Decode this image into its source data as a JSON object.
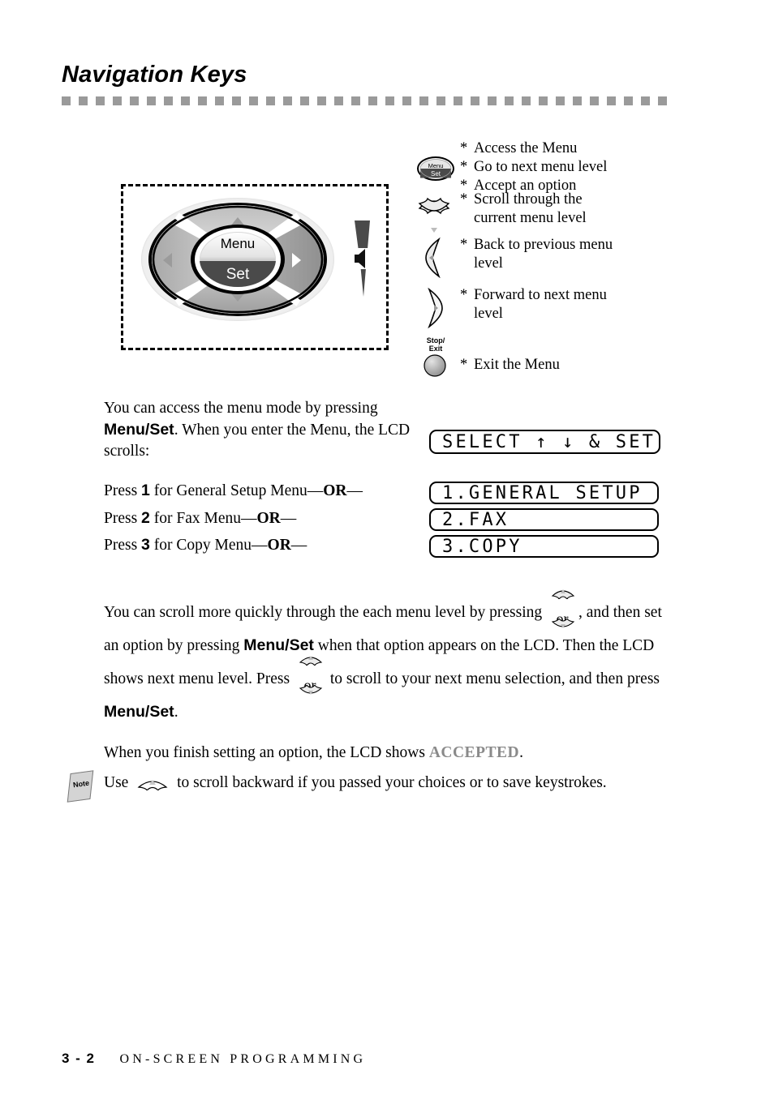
{
  "page": {
    "title": "Navigation Keys"
  },
  "diagram": {
    "navpad": {
      "center_top_label": "Menu",
      "center_bottom_label": "Set",
      "up_key": "up-arrow-key",
      "down_key": "down-arrow-key",
      "left_key": "left-arrow-key",
      "right_key": "right-arrow-key"
    },
    "volume_icon": "speaker-volume-icon"
  },
  "legend": [
    {
      "icon": "menu-set-key-icon",
      "lines": [
        "Access the Menu",
        "Go to next menu level",
        "Accept an option"
      ]
    },
    {
      "icon": "up-down-arrow-keys-icon",
      "lines": [
        "Scroll through the",
        "current menu level"
      ]
    },
    {
      "icon": "left-arrow-key-icon",
      "lines": [
        "Back to previous menu",
        "level"
      ]
    },
    {
      "icon": "right-arrow-key-icon",
      "lines": [
        "Forward to next menu",
        "level"
      ]
    },
    {
      "icon": "stop-exit-key-icon",
      "icon_label_line1": "Stop/",
      "icon_label_line2": "Exit",
      "lines": [
        "Exit the Menu"
      ]
    }
  ],
  "body": {
    "access_paragraph": {
      "part1": "You can access the menu mode by pressing ",
      "bold1": "Menu/Set",
      "part2": ". When you enter the Menu, the LCD scrolls:"
    },
    "press_lines": [
      {
        "prefix": "Press ",
        "number": "1",
        "middle": " for General Setup Menu",
        "dash1": "—",
        "or": "OR",
        "dash2": "—"
      },
      {
        "prefix": "Press ",
        "number": "2",
        "middle": " for Fax Menu",
        "dash1": "—",
        "or": "OR",
        "dash2": "—"
      },
      {
        "prefix": "Press ",
        "number": "3",
        "middle": " for Copy Menu",
        "dash1": "—",
        "or": "OR",
        "dash2": "—"
      }
    ],
    "scroll_paragraph": {
      "seg1": "You can scroll more quickly through the each menu level by pressing",
      "or_word_1": "or",
      "seg2": ", and then set an option by pressing ",
      "bold1": "Menu/Set",
      "seg3": " when that option appears on the LCD. Then the LCD shows next menu level. Press",
      "or_word_2": "or",
      "seg4": " to scroll to your next menu selection, and then press ",
      "bold2": "Menu/Set",
      "seg5": "."
    },
    "accepted_paragraph": {
      "part1": "When you finish setting an option, the LCD shows ",
      "highlight": "ACCEPTED",
      "part2": "."
    },
    "note": {
      "icon_label": "Note",
      "part1": "Use",
      "part2": " to scroll backward if you passed your choices or to save keystrokes."
    }
  },
  "lcd_displays": [
    {
      "name": "lcd-select",
      "text": "SELECT ↑ ↓ & SET"
    },
    {
      "name": "lcd-general-setup",
      "text": "1.GENERAL SETUP"
    },
    {
      "name": "lcd-fax",
      "text": "2.FAX"
    },
    {
      "name": "lcd-copy",
      "text": "3.COPY"
    }
  ],
  "footer": {
    "page_number": "3 - 2",
    "section": "ON-SCREEN PROGRAMMING"
  },
  "colors": {
    "rule": "#9a9a9a",
    "accepted": "#8a8a8a",
    "key_dark": "#4a4a4a"
  }
}
